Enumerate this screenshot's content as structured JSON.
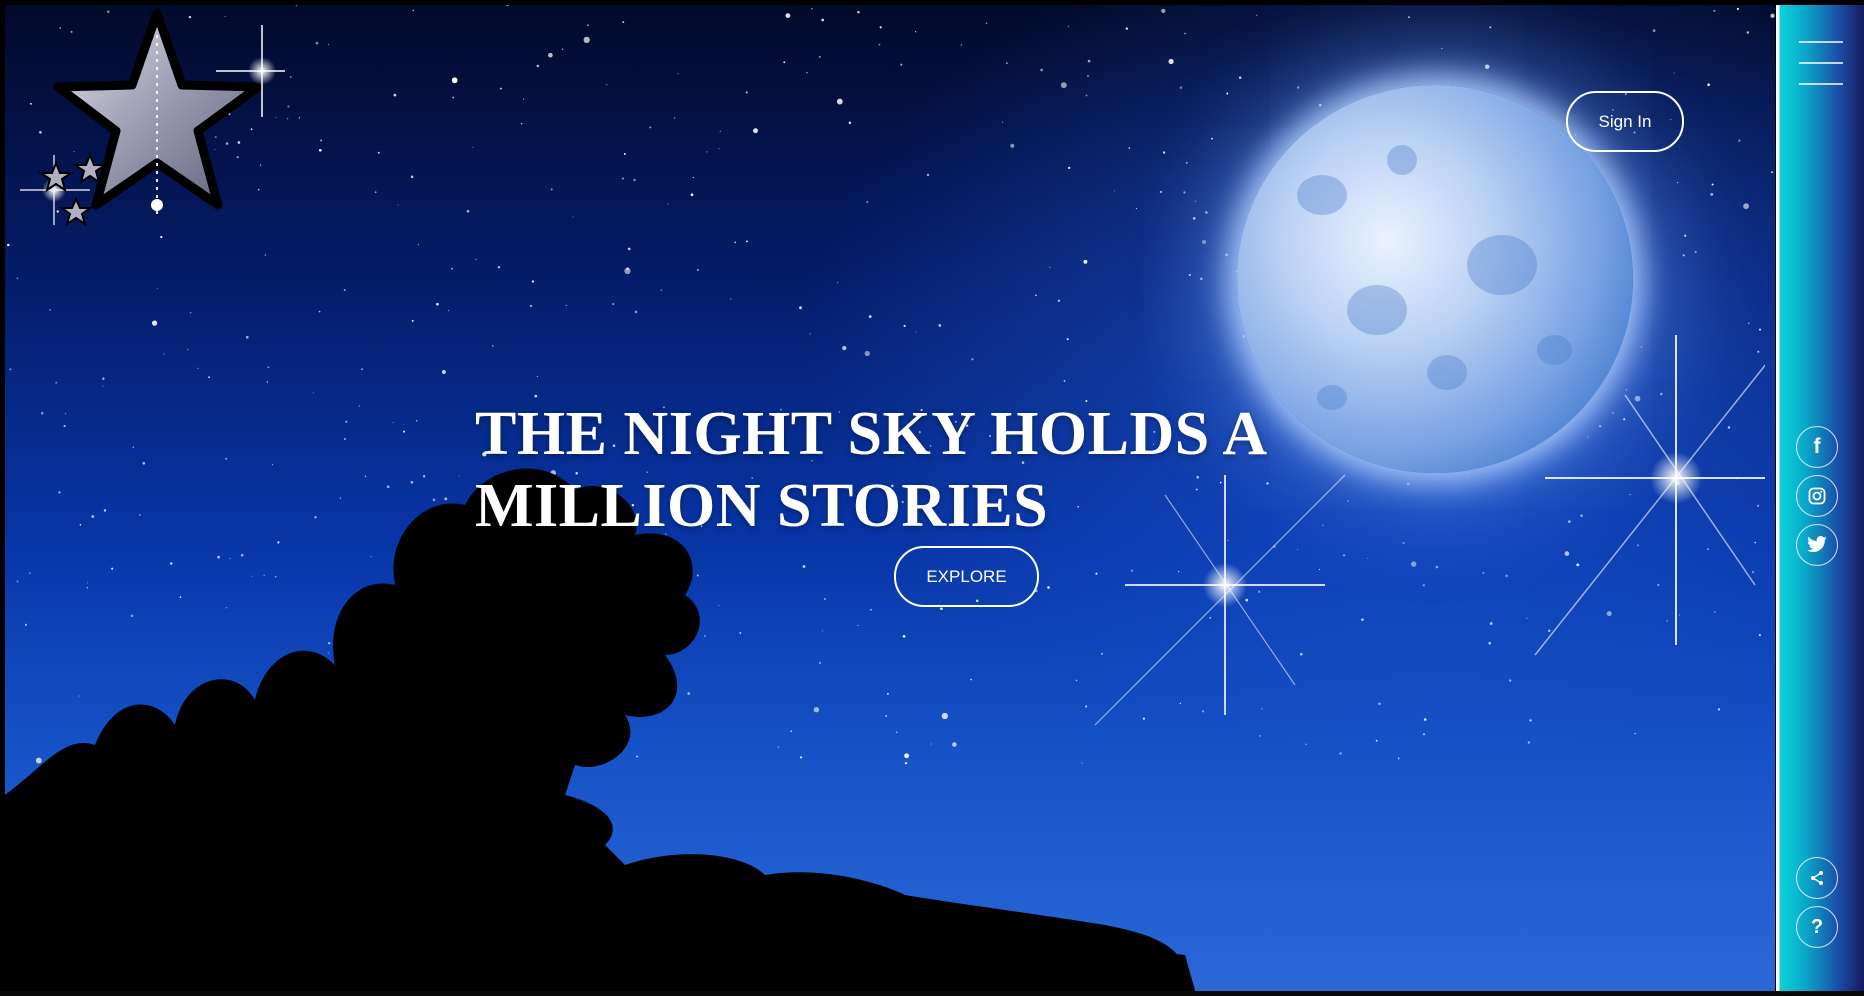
{
  "hero": {
    "title": "THE NIGHT SKY HOLDS A MILLION STORIES",
    "explore_label": "EXPLORE",
    "signin_label": "Sign In"
  },
  "rail": {
    "menu_icon": "hamburger-menu-icon",
    "social": [
      "facebook-icon",
      "instagram-icon",
      "twitter-icon"
    ],
    "share_icon": "share-icon",
    "help_icon": "help-icon",
    "help_glyph": "?",
    "facebook_glyph": "f"
  },
  "colors": {
    "sky_top": "#020a2a",
    "sky_bottom": "#2a68d6",
    "rail_cyan": "#0bd3d9",
    "rail_navy": "#15195e"
  }
}
